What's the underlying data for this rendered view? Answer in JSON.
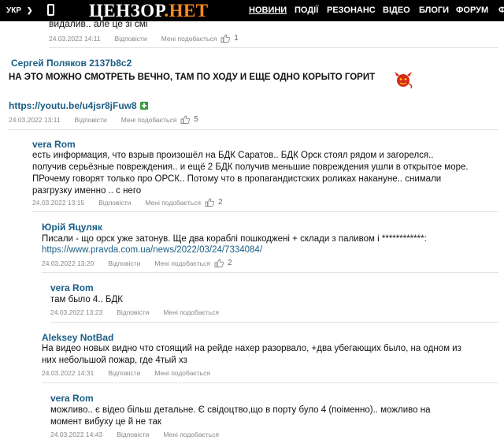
{
  "header": {
    "lang": "УКР",
    "logo_part1": "ЦЕНЗОР",
    "logo_dot": ".",
    "logo_part2": "НЕТ",
    "nav": [
      "НОВИНИ",
      "ПОДІЇ",
      "РЕЗОНАНС",
      "ВІДЕО",
      "БЛОГИ",
      "ФОРУМ",
      "Ф"
    ]
  },
  "labels": {
    "reply": "Відповісти",
    "like": "Мені подобається"
  },
  "colors": {
    "link": "#1a5e85",
    "topbar": "#000000",
    "logo_accent": "#ff8a1f"
  },
  "fragment": {
    "text": "видалив.. але це зі смі",
    "date": "24.03.2022 14:11",
    "likes": "1"
  },
  "comments": [
    {
      "author": "Сергей Поляков 2137b8c2",
      "text": "НА ЭТО МОЖНО СМОТРЕТЬ ВЕЧНО, ТАМ ПО ХОДУ И ЕЩЕ ОДНО КОРЫТО ГОРИТ",
      "link": "https://youtu.be/u4jsr8jFuw8",
      "date": "24.03.2022 13:11",
      "likes": "5"
    },
    {
      "author": "vera Rom",
      "text": "есть информация, что взрыв произошёл на БДК Саратов.. БДК Орск стоял рядом и загорелся.. получив серьёзные повреждения.. и ещё 2 БДК получив меньшие повреждения ушли в открытое море. ПРочему говорят только про ОРСК.. Потому что в пропагандистских роликах накануне.. снимали разгрузку именно .. с него",
      "date": "24.03.2022 13:15",
      "likes": "2"
    },
    {
      "author": "Юрій Яцуляк",
      "text": "Писали - що орск уже затонув. Ще два кораблі пошкоджені + склади з паливом і ************:",
      "link": "https://www.pravda.com.ua/news/2022/03/24/7334084/",
      "date": "24.03.2022 13:20",
      "likes": "2"
    },
    {
      "author": "vera Rom",
      "text": "там было 4.. БДК",
      "date": "24.03.2022 13:23"
    },
    {
      "author": "Aleksey NotBad",
      "text": "На видео новых видно что стоящий на рейде нахер разорвало, +два убегающих было, на одном из них небольшой пожар, где 4тый хз",
      "date": "24.03.2022 14:31"
    },
    {
      "author": "vera Rom",
      "text": "можливо.. є відео більш детальне. Є свідоцтво,що в порту було 4 (поіменно).. можливо на момент вибуху це й не так",
      "date": "24.03.2022 14:43"
    }
  ]
}
